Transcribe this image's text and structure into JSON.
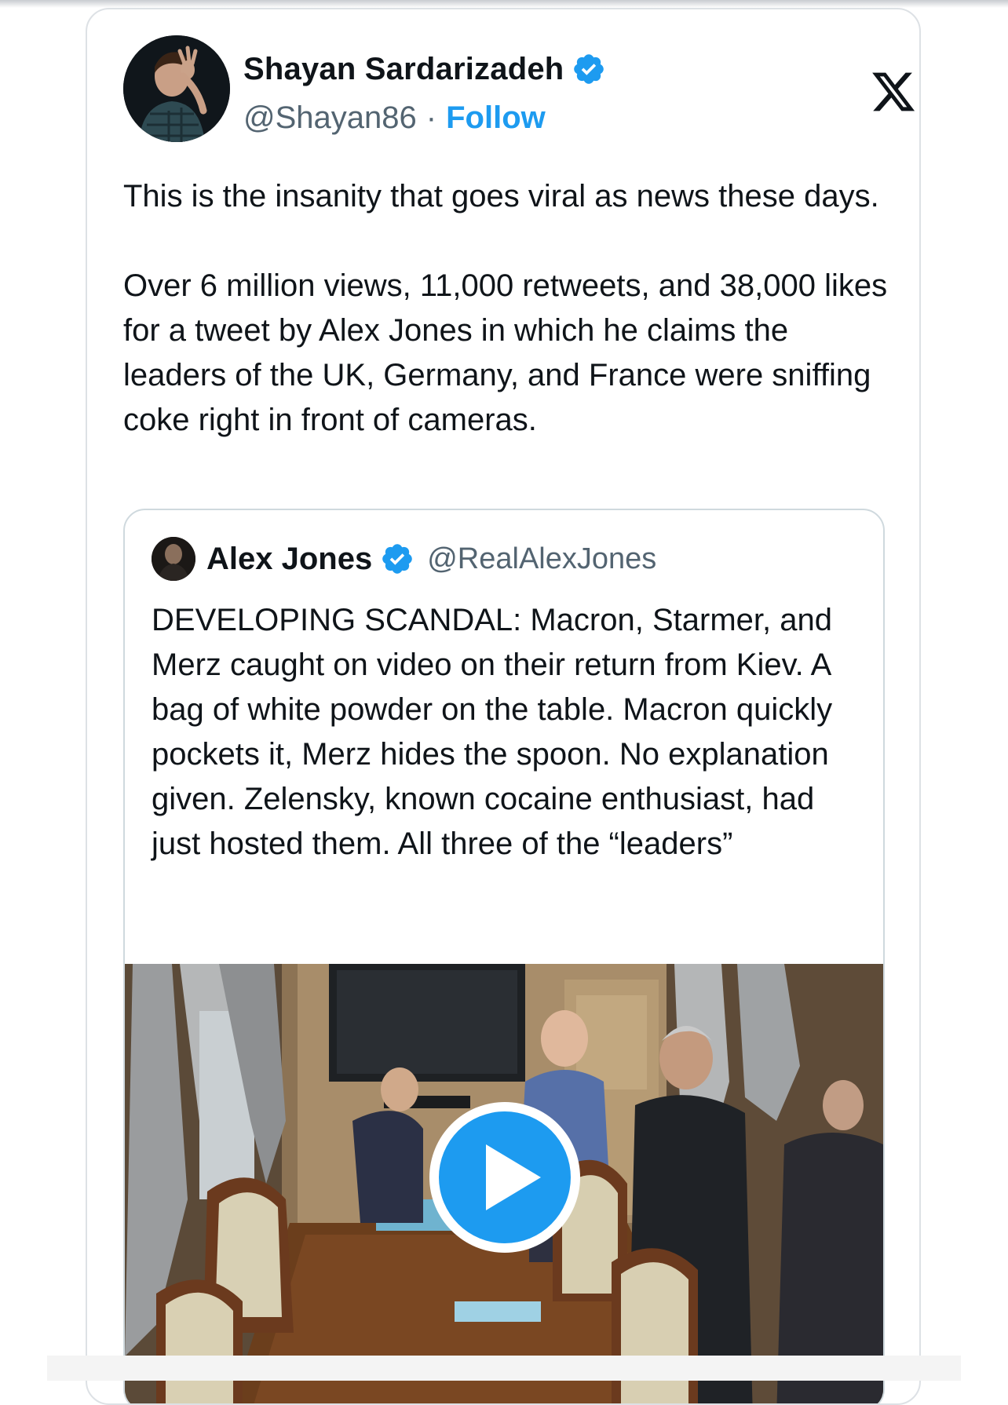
{
  "tweet": {
    "author": {
      "display_name": "Shayan Sardarizadeh",
      "handle": "@Shayan86",
      "separator": "·",
      "follow_label": "Follow",
      "verified_color": "#1d9bf0"
    },
    "platform_icon": "x-logo-icon",
    "text": "This is the insanity that goes viral as news these days.\n\nOver 6 million views, 11,000 retweets, and 38,000 likes for a tweet by Alex Jones in which he claims the leaders of the UK, Germany, and France were sniffing coke right in front of cameras."
  },
  "quoted_tweet": {
    "author": {
      "display_name": "Alex Jones",
      "handle": "@RealAlexJones"
    },
    "text": "DEVELOPING SCANDAL: Macron, Starmer, and Merz caught on video on their return from Kiev. A bag of white powder on the table. Macron quickly pockets it, Merz hides the spoon. No explanation given. Zelensky, known cocaine enthusiast, had just hosted them. All three of the “leaders”",
    "media": {
      "type": "video",
      "play_icon": "play-icon"
    }
  },
  "colors": {
    "accent": "#1d9bf0",
    "text_primary": "#0f1419",
    "text_secondary": "#536471",
    "border": "#cfd9de"
  }
}
